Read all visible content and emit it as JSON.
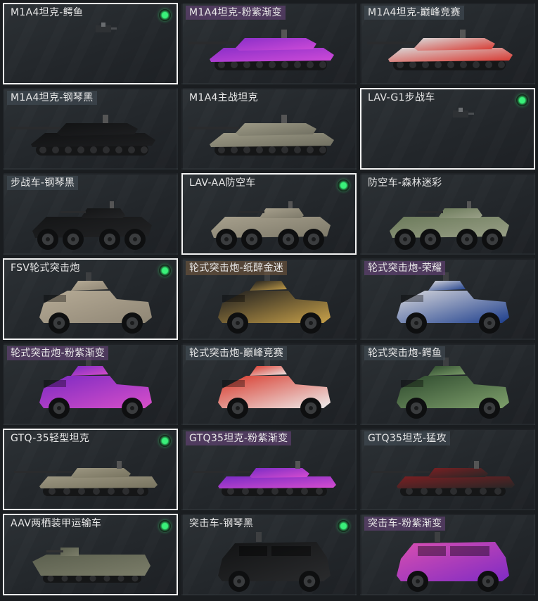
{
  "vehicles": [
    {
      "name": "M1A4坦克-鳄鱼",
      "type": "tank",
      "skin": [
        "#242628",
        "#2e3134"
      ],
      "selected": true,
      "owned": true,
      "label_style": "plain",
      "partial": true
    },
    {
      "name": "M1A4坦克-粉紫渐变",
      "type": "tank",
      "skin": [
        "#8a2fc8",
        "#d04bd8"
      ],
      "selected": false,
      "owned": false,
      "label_style": "purple"
    },
    {
      "name": "M1A4坦克-巅峰竞赛",
      "type": "tank",
      "skin": [
        "#d9d9d9",
        "#d8342c"
      ],
      "selected": false,
      "owned": false,
      "label_style": "blue"
    },
    {
      "name": "M1A4坦克-钢琴黑",
      "type": "tank",
      "skin": [
        "#121314",
        "#1d1e20"
      ],
      "selected": false,
      "owned": false,
      "label_style": "blue"
    },
    {
      "name": "M1A4主战坦克",
      "type": "tank",
      "skin": [
        "#9d9a86",
        "#6f6e60"
      ],
      "selected": false,
      "owned": false,
      "label_style": "plain"
    },
    {
      "name": "LAV-G1步战车",
      "type": "apc",
      "skin": [
        "#2a2c2e",
        "#3a3c3e"
      ],
      "selected": true,
      "owned": true,
      "label_style": "plain",
      "partial": true
    },
    {
      "name": "步战车-钢琴黑",
      "type": "apc",
      "skin": [
        "#141516",
        "#222325"
      ],
      "selected": false,
      "owned": false,
      "label_style": "blue"
    },
    {
      "name": "LAV-AA防空车",
      "type": "apc",
      "skin": [
        "#a7a08d",
        "#7d7969"
      ],
      "selected": true,
      "owned": true,
      "label_style": "plain"
    },
    {
      "name": "防空车-森林迷彩",
      "type": "apc",
      "skin": [
        "#6b7a5a",
        "#9aa088"
      ],
      "selected": false,
      "owned": false,
      "label_style": "plain"
    },
    {
      "name": "FSV轮式突击炮",
      "type": "wheeled",
      "skin": [
        "#b6ab96",
        "#8f8675"
      ],
      "selected": true,
      "owned": true,
      "label_style": "plain"
    },
    {
      "name": "轮式突击炮-纸醉金迷",
      "type": "wheeled",
      "skin": [
        "#1c1c1e",
        "#c9a24a"
      ],
      "selected": false,
      "owned": false,
      "label_style": "gold"
    },
    {
      "name": "轮式突击炮-荣耀",
      "type": "wheeled",
      "skin": [
        "#d8d8dc",
        "#1c3d8c"
      ],
      "selected": false,
      "owned": false,
      "label_style": "purple"
    },
    {
      "name": "轮式突击炮-粉紫渐变",
      "type": "wheeled",
      "skin": [
        "#7b2ac2",
        "#d84fc9"
      ],
      "selected": false,
      "owned": false,
      "label_style": "purple"
    },
    {
      "name": "轮式突击炮-巅峰竞赛",
      "type": "wheeled",
      "skin": [
        "#d8382a",
        "#eeeeee"
      ],
      "selected": false,
      "owned": false,
      "label_style": "blue"
    },
    {
      "name": "轮式突击炮-鳄鱼",
      "type": "wheeled",
      "skin": [
        "#2e4a2e",
        "#7fa06c"
      ],
      "selected": false,
      "owned": false,
      "label_style": "blue"
    },
    {
      "name": "GTQ-35轻型坦克",
      "type": "light",
      "skin": [
        "#9c9681",
        "#77735f"
      ],
      "selected": true,
      "owned": true,
      "label_style": "plain"
    },
    {
      "name": "GTQ35坦克-粉紫渐变",
      "type": "light",
      "skin": [
        "#7a2bc4",
        "#d74dd0"
      ],
      "selected": false,
      "owned": false,
      "label_style": "purple"
    },
    {
      "name": "GTQ35坦克-猛攻",
      "type": "light",
      "skin": [
        "#7a1f22",
        "#262626"
      ],
      "selected": false,
      "owned": false,
      "label_style": "blue"
    },
    {
      "name": "AAV两栖装甲运输车",
      "type": "aav",
      "skin": [
        "#5c604f",
        "#7b7d69"
      ],
      "selected": true,
      "owned": true,
      "label_style": "plain"
    },
    {
      "name": "突击车-钢琴黑",
      "type": "suv",
      "skin": [
        "#121314",
        "#2a2b2d"
      ],
      "selected": false,
      "owned": true,
      "label_style": "plain"
    },
    {
      "name": "突击车-粉紫渐变",
      "type": "suv",
      "skin": [
        "#d94fb0",
        "#7f2bc4"
      ],
      "selected": false,
      "owned": false,
      "label_style": "purple"
    }
  ]
}
